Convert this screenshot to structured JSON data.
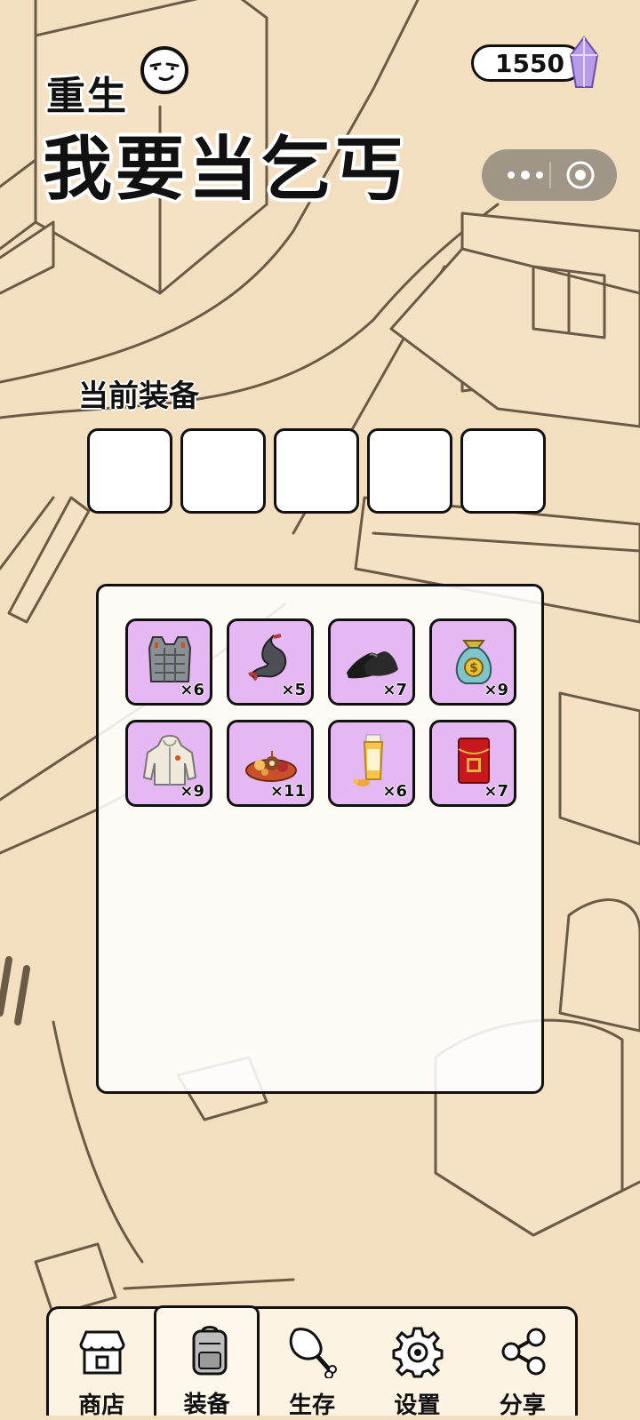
{
  "app": {
    "title_line1": "重生",
    "title_line2": "我要当乞丐"
  },
  "currency": {
    "amount": "1550",
    "icon": "purple-crystal-icon"
  },
  "capsule": {
    "more_icon": "more-dots-icon",
    "close_icon": "target-circle-icon"
  },
  "equipment": {
    "title": "当前装备",
    "slot_count": 5
  },
  "inventory": {
    "items": [
      {
        "name": "armor-vest",
        "icon": "armor-vest-icon",
        "count": "×6"
      },
      {
        "name": "stomach",
        "icon": "stomach-icon",
        "count": "×5"
      },
      {
        "name": "black-shoes",
        "icon": "shoe-icon",
        "count": "×7"
      },
      {
        "name": "money-bag",
        "icon": "money-bag-icon",
        "count": "×9"
      },
      {
        "name": "hoodie",
        "icon": "hoodie-icon",
        "count": "×9"
      },
      {
        "name": "food-platter",
        "icon": "platter-icon",
        "count": "×11"
      },
      {
        "name": "sunscreen",
        "icon": "sunscreen-tube-icon",
        "count": "×6"
      },
      {
        "name": "red-envelope",
        "icon": "red-envelope-icon",
        "count": "×7"
      }
    ]
  },
  "nav": {
    "items": [
      {
        "label": "商店",
        "icon": "shop-icon",
        "active": false
      },
      {
        "label": "装备",
        "icon": "backpack-icon",
        "active": true
      },
      {
        "label": "生存",
        "icon": "drumstick-icon",
        "active": false
      },
      {
        "label": "设置",
        "icon": "gear-icon",
        "active": false
      },
      {
        "label": "分享",
        "icon": "share-icon",
        "active": false
      }
    ]
  },
  "colors": {
    "background": "#f3dfbf",
    "item_bg": "#e6b8f3",
    "outline": "#111111"
  }
}
